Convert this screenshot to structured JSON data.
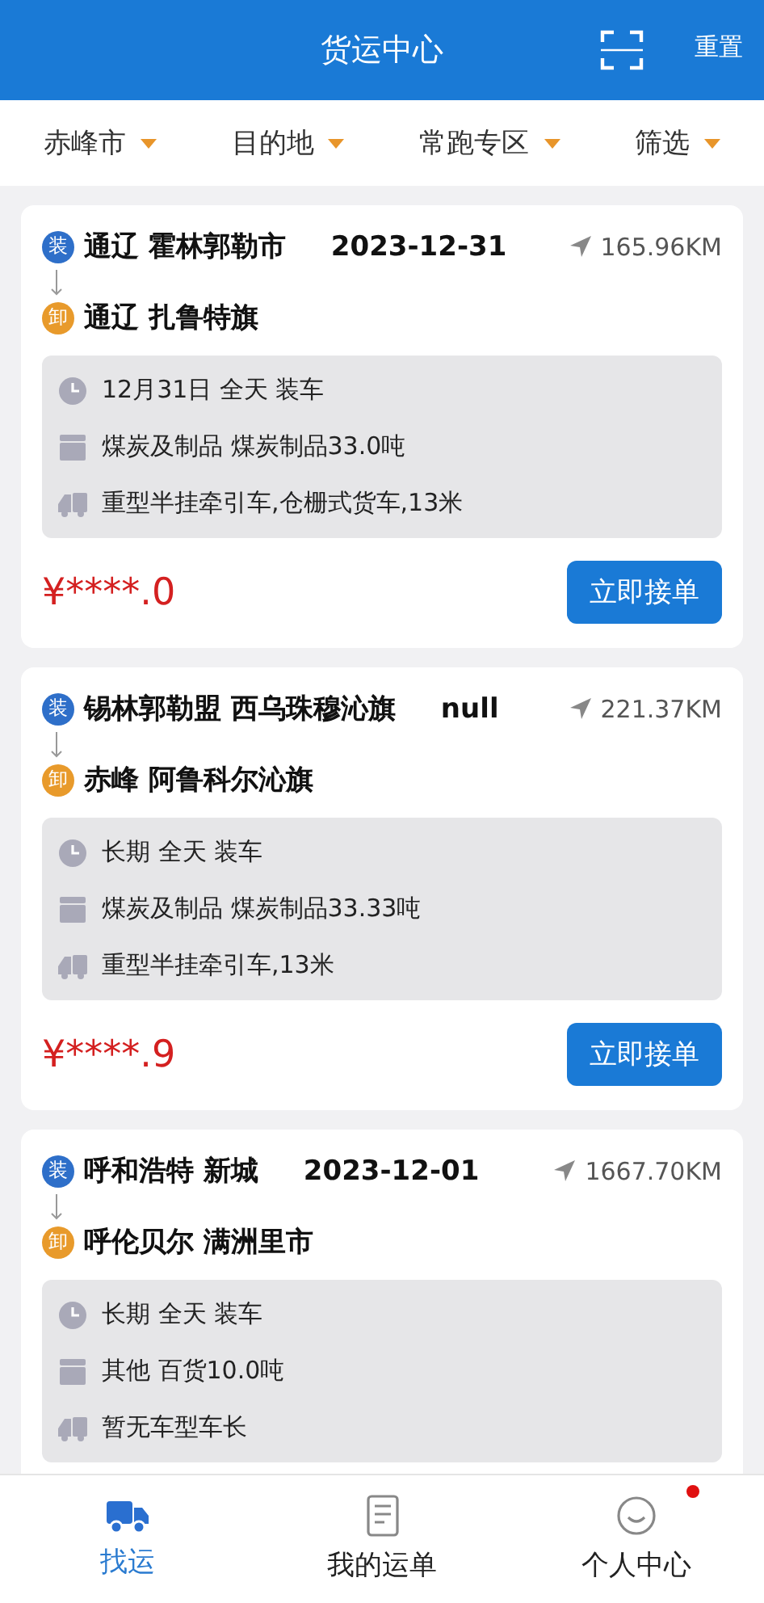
{
  "header": {
    "title": "货运中心",
    "reset": "重置"
  },
  "filters": [
    {
      "label": "赤峰市"
    },
    {
      "label": "目的地"
    },
    {
      "label": "常跑专区"
    },
    {
      "label": "筛选"
    }
  ],
  "orders": [
    {
      "load_badge": "装",
      "origin": "通辽 霍林郭勒市",
      "date": "2023-12-31",
      "distance": "165.96KM",
      "unload_badge": "卸",
      "destination": "通辽 扎鲁特旗",
      "time": "12月31日  全天 装车",
      "cargo": "煤炭及制品  煤炭制品33.0吨",
      "vehicle": "重型半挂牵引车,仓栅式货车,13米",
      "price": "¥****.0",
      "action": "立即接单"
    },
    {
      "load_badge": "装",
      "origin": "锡林郭勒盟 西乌珠穆沁旗",
      "date": "null",
      "distance": "221.37KM",
      "unload_badge": "卸",
      "destination": "赤峰 阿鲁科尔沁旗",
      "time": "长期  全天 装车",
      "cargo": "煤炭及制品  煤炭制品33.33吨",
      "vehicle": "重型半挂牵引车,13米",
      "price": "¥****.9",
      "action": "立即接单"
    },
    {
      "load_badge": "装",
      "origin": "呼和浩特 新城",
      "date": "2023-12-01",
      "distance": "1667.70KM",
      "unload_badge": "卸",
      "destination": "呼伦贝尔 满洲里市",
      "time": "长期  全天 装车",
      "cargo": "其他  百货10.0吨",
      "vehicle": "暂无车型车长"
    }
  ],
  "tabs": [
    {
      "label": "找运",
      "kind": "truck",
      "selected": true,
      "badge": false
    },
    {
      "label": "我的运单",
      "kind": "document",
      "selected": false,
      "badge": false
    },
    {
      "label": "个人中心",
      "kind": "face",
      "selected": false,
      "badge": true
    }
  ]
}
